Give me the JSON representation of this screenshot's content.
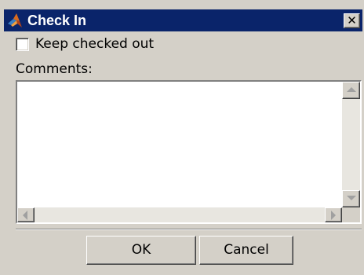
{
  "window": {
    "title": "Check In",
    "close_glyph": "✕",
    "app_icon": "matlab-logo-icon"
  },
  "options": {
    "keep_checked_out_label": "Keep checked out",
    "keep_checked_out_checked": false
  },
  "comments": {
    "label": "Comments:",
    "value": ""
  },
  "buttons": {
    "ok_label": "OK",
    "cancel_label": "Cancel"
  },
  "colors": {
    "titlebar": "#0a246a",
    "face": "#d4d0c8"
  }
}
